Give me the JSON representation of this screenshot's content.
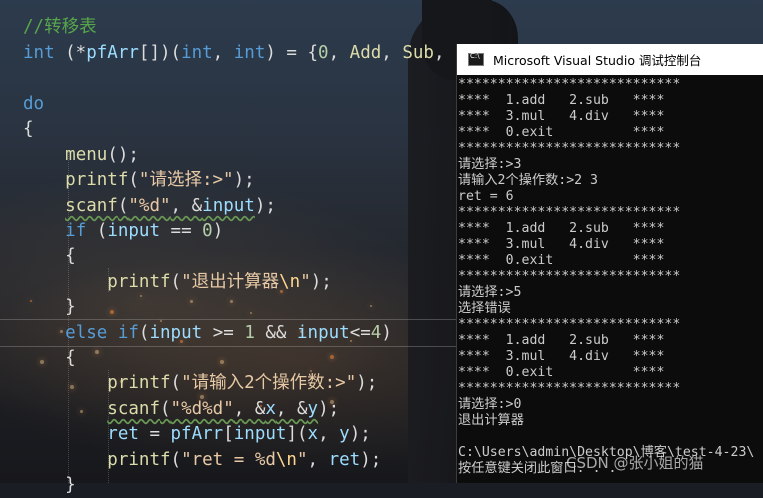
{
  "editor": {
    "lines": [
      {
        "parts": [
          {
            "t": "//转移表",
            "c": "c-comment"
          }
        ]
      },
      {
        "parts": [
          {
            "t": "int",
            "c": "c-kw"
          },
          {
            "t": " (*",
            "c": "c-plain"
          },
          {
            "t": "pfArr",
            "c": "c-var"
          },
          {
            "t": "[])(",
            "c": "c-plain"
          },
          {
            "t": "int",
            "c": "c-kw"
          },
          {
            "t": ", ",
            "c": "c-plain"
          },
          {
            "t": "int",
            "c": "c-kw"
          },
          {
            "t": ") = {",
            "c": "c-plain"
          },
          {
            "t": "0",
            "c": "c-num"
          },
          {
            "t": ", ",
            "c": "c-plain"
          },
          {
            "t": "Add",
            "c": "c-fn"
          },
          {
            "t": ", ",
            "c": "c-plain"
          },
          {
            "t": "Sub",
            "c": "c-fn"
          },
          {
            "t": ",",
            "c": "c-plain"
          }
        ]
      },
      {
        "parts": []
      },
      {
        "parts": [
          {
            "t": "do",
            "c": "c-kw"
          }
        ]
      },
      {
        "parts": [
          {
            "t": "{",
            "c": "c-plain"
          }
        ]
      },
      {
        "parts": [
          {
            "t": "    ",
            "c": "c-plain"
          },
          {
            "t": "menu",
            "c": "c-fn"
          },
          {
            "t": "();",
            "c": "c-plain"
          }
        ]
      },
      {
        "parts": [
          {
            "t": "    ",
            "c": "c-plain"
          },
          {
            "t": "printf",
            "c": "c-fn"
          },
          {
            "t": "(",
            "c": "c-plain"
          },
          {
            "t": "\"请选择:>\"",
            "c": "c-str"
          },
          {
            "t": ");",
            "c": "c-plain"
          }
        ]
      },
      {
        "parts": [
          {
            "t": "    ",
            "c": "c-plain"
          },
          {
            "t": "scanf",
            "c": "c-fn squiggle"
          },
          {
            "t": "(",
            "c": "c-plain squiggle"
          },
          {
            "t": "\"%d\"",
            "c": "c-str squiggle"
          },
          {
            "t": ", &",
            "c": "c-plain squiggle"
          },
          {
            "t": "input",
            "c": "c-var squiggle"
          },
          {
            "t": ");",
            "c": "c-plain"
          }
        ]
      },
      {
        "parts": [
          {
            "t": "    ",
            "c": "c-plain"
          },
          {
            "t": "if",
            "c": "c-kw"
          },
          {
            "t": " (",
            "c": "c-plain"
          },
          {
            "t": "input",
            "c": "c-var"
          },
          {
            "t": " == ",
            "c": "c-plain"
          },
          {
            "t": "0",
            "c": "c-num"
          },
          {
            "t": ")",
            "c": "c-plain"
          }
        ]
      },
      {
        "parts": [
          {
            "t": "    {",
            "c": "c-plain"
          }
        ]
      },
      {
        "parts": [
          {
            "t": "        ",
            "c": "c-plain"
          },
          {
            "t": "printf",
            "c": "c-fn"
          },
          {
            "t": "(",
            "c": "c-plain"
          },
          {
            "t": "\"退出计算器",
            "c": "c-str"
          },
          {
            "t": "\\n",
            "c": "c-esc"
          },
          {
            "t": "\"",
            "c": "c-str"
          },
          {
            "t": ");",
            "c": "c-plain"
          }
        ]
      },
      {
        "parts": [
          {
            "t": "    }",
            "c": "c-plain"
          }
        ]
      },
      {
        "parts": [
          {
            "t": "    ",
            "c": "c-plain"
          },
          {
            "t": "else if",
            "c": "c-kw"
          },
          {
            "t": "(",
            "c": "c-plain"
          },
          {
            "t": "input",
            "c": "c-var"
          },
          {
            "t": " >= ",
            "c": "c-plain"
          },
          {
            "t": "1",
            "c": "c-num"
          },
          {
            "t": " && ",
            "c": "c-plain"
          },
          {
            "t": "input",
            "c": "c-var"
          },
          {
            "t": "<=",
            "c": "c-plain"
          },
          {
            "t": "4",
            "c": "c-num"
          },
          {
            "t": ")",
            "c": "c-plain"
          }
        ]
      },
      {
        "parts": [
          {
            "t": "    {",
            "c": "c-plain"
          }
        ]
      },
      {
        "parts": [
          {
            "t": "        ",
            "c": "c-plain"
          },
          {
            "t": "printf",
            "c": "c-fn"
          },
          {
            "t": "(",
            "c": "c-plain"
          },
          {
            "t": "\"请输入2个操作数:>\"",
            "c": "c-str"
          },
          {
            "t": ");",
            "c": "c-plain"
          }
        ]
      },
      {
        "parts": [
          {
            "t": "        ",
            "c": "c-plain"
          },
          {
            "t": "scanf",
            "c": "c-fn squiggle"
          },
          {
            "t": "(",
            "c": "c-plain squiggle"
          },
          {
            "t": "\"%d%d\"",
            "c": "c-str squiggle"
          },
          {
            "t": ", &",
            "c": "c-plain squiggle"
          },
          {
            "t": "x",
            "c": "c-var squiggle"
          },
          {
            "t": ", &",
            "c": "c-plain squiggle"
          },
          {
            "t": "y",
            "c": "c-var squiggle"
          },
          {
            "t": ");",
            "c": "c-plain"
          }
        ]
      },
      {
        "parts": [
          {
            "t": "        ",
            "c": "c-plain"
          },
          {
            "t": "ret",
            "c": "c-var"
          },
          {
            "t": " = ",
            "c": "c-plain"
          },
          {
            "t": "pfArr",
            "c": "c-var"
          },
          {
            "t": "[",
            "c": "c-plain"
          },
          {
            "t": "input",
            "c": "c-var"
          },
          {
            "t": "](",
            "c": "c-plain"
          },
          {
            "t": "x",
            "c": "c-var"
          },
          {
            "t": ", ",
            "c": "c-plain"
          },
          {
            "t": "y",
            "c": "c-var"
          },
          {
            "t": ");",
            "c": "c-plain"
          }
        ]
      },
      {
        "parts": [
          {
            "t": "        ",
            "c": "c-plain"
          },
          {
            "t": "printf",
            "c": "c-fn"
          },
          {
            "t": "(",
            "c": "c-plain"
          },
          {
            "t": "\"ret = %d",
            "c": "c-str"
          },
          {
            "t": "\\n",
            "c": "c-esc"
          },
          {
            "t": "\"",
            "c": "c-str"
          },
          {
            "t": ", ",
            "c": "c-plain"
          },
          {
            "t": "ret",
            "c": "c-var"
          },
          {
            "t": ");",
            "c": "c-plain"
          }
        ]
      },
      {
        "parts": [
          {
            "t": "    }",
            "c": "c-plain"
          }
        ]
      }
    ]
  },
  "console": {
    "title": "Microsoft Visual Studio 调试控制台",
    "lines": [
      "****************************",
      "****  1.add   2.sub   ****",
      "****  3.mul   4.div   ****",
      "****  0.exit          ****",
      "****************************",
      "请选择:>3",
      "请输入2个操作数:>2 3",
      "ret = 6",
      "****************************",
      "****  1.add   2.sub   ****",
      "****  3.mul   4.div   ****",
      "****  0.exit          ****",
      "****************************",
      "请选择:>5",
      "选择错误",
      "****************************",
      "****  1.add   2.sub   ****",
      "****  3.mul   4.div   ****",
      "****  0.exit          ****",
      "****************************",
      "请选择:>0",
      "退出计算器",
      "",
      "C:\\Users\\admin\\Desktop\\博客\\test-4-23\\",
      "按任意键关闭此窗口. . ."
    ]
  },
  "watermark": "CSDN @张小姐的猫",
  "colors": {
    "comment": "#57a64a",
    "keyword": "#569cd6",
    "function": "#dcdcaa",
    "string": "#e8c9a5",
    "variable": "#9cdcfe",
    "number": "#b5cea8",
    "console_bg": "#0c0c0c",
    "console_text": "#cccccc"
  }
}
